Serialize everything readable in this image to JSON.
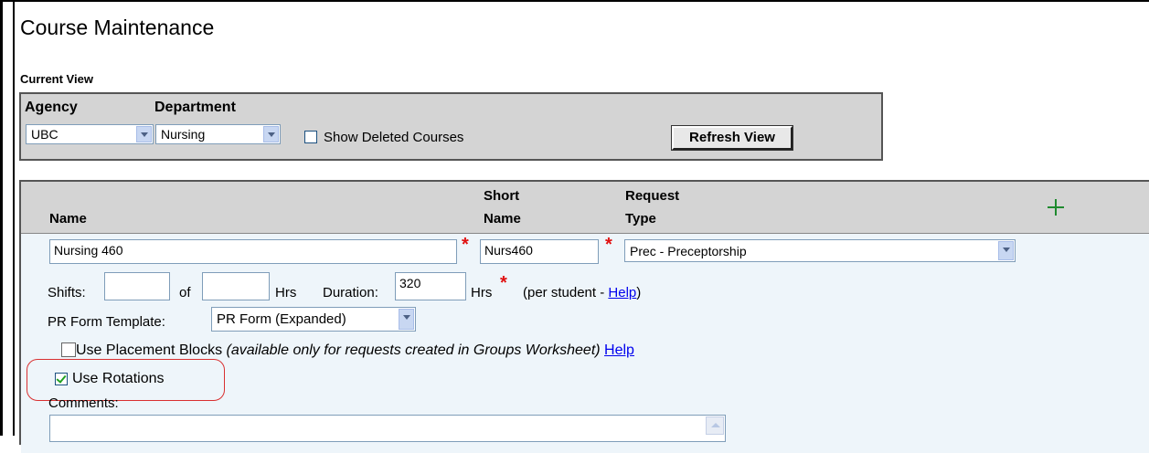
{
  "page": {
    "title": "Course Maintenance"
  },
  "current_view": {
    "label": "Current View",
    "agency_label": "Agency",
    "agency_value": "UBC",
    "department_label": "Department",
    "department_value": "Nursing",
    "show_deleted_label": "Show Deleted Courses",
    "show_deleted_checked": false,
    "refresh_label": "Refresh View"
  },
  "grid": {
    "headers": {
      "name": "Name",
      "short_name_1": "Short",
      "short_name_2": "Name",
      "request_type_1": "Request",
      "request_type_2": "Type"
    },
    "row": {
      "name_value": "Nursing 460",
      "short_name_value": "Nurs460",
      "request_type_value": "Prec - Preceptorship",
      "shifts_label": "Shifts:",
      "shifts_value": "",
      "of_label": "of",
      "hrs_value": "",
      "hrs_label": "Hrs",
      "duration_label": "Duration:",
      "duration_value": "320",
      "duration_unit": "Hrs",
      "per_student_prefix": "(per student - ",
      "per_student_help": "Help",
      "per_student_suffix": ")",
      "pr_form_label": "PR Form Template:",
      "pr_form_value": "PR Form (Expanded)",
      "placement_blocks_label": "Use Placement Blocks",
      "placement_blocks_note": "(available only for requests created in Groups Worksheet)",
      "placement_blocks_help": "Help",
      "placement_blocks_checked": false,
      "rotations_label": "Use Rotations",
      "rotations_checked": true,
      "comments_label": "Comments:"
    }
  },
  "colors": {
    "required": "#e01010",
    "add": "#1f8a2f",
    "highlight": "#d93030",
    "link": "#0000ee"
  }
}
